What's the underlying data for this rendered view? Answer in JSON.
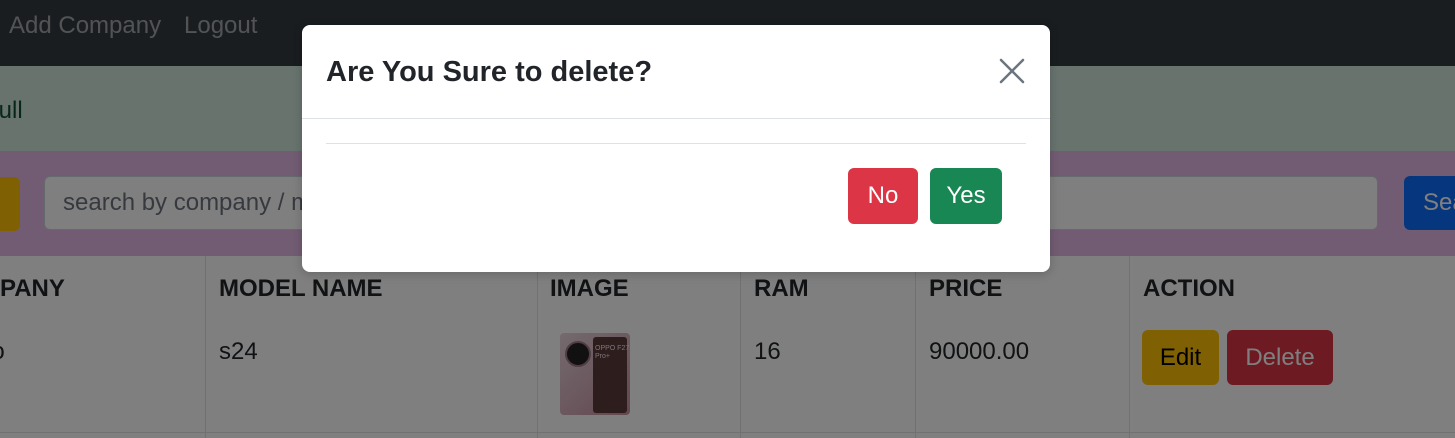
{
  "navbar": {
    "links": [
      {
        "label": "Add Company"
      },
      {
        "label": "Logout"
      }
    ]
  },
  "alert": {
    "text": "sfull"
  },
  "search": {
    "placeholder": "search by company / model",
    "button_label": "Search"
  },
  "table": {
    "headers": [
      "MPANY",
      "MODEL NAME",
      "IMAGE",
      "RAM",
      "PRICE",
      "ACTION"
    ],
    "rows": [
      {
        "company": "po",
        "model": "s24",
        "image_text": "OPPO F27 Pro+",
        "ram": "16",
        "price": "90000.00",
        "edit_label": "Edit",
        "delete_label": "Delete"
      }
    ]
  },
  "modal": {
    "title": "Are You Sure to delete?",
    "close_icon": "close-icon",
    "no_label": "No",
    "yes_label": "Yes"
  },
  "colors": {
    "navbar": "#343a40",
    "alert_bg": "#d1e7dd",
    "search_bg": "#e4b8e6",
    "warning": "#ffc107",
    "danger": "#dc3545",
    "success": "#198754",
    "primary": "#0d6efd"
  }
}
